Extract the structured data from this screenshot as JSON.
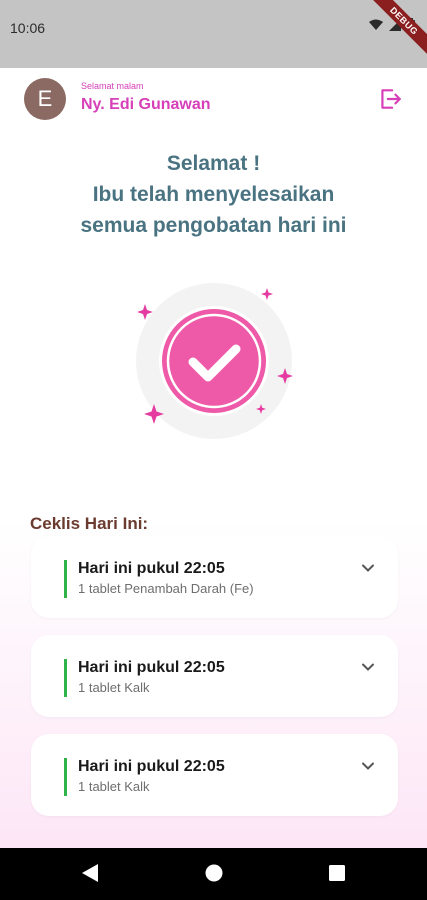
{
  "status_bar": {
    "time": "10:06",
    "debug_label": "DEBUG"
  },
  "header": {
    "avatar_initial": "E",
    "greeting": "Selamat malam",
    "user_name": "Ny. Edi Gunawan"
  },
  "congrats": {
    "line1": "Selamat !",
    "line2": "Ibu telah menyelesaikan",
    "line3": "semua pengobatan hari ini"
  },
  "checklist": {
    "title": "Ceklis Hari Ini:",
    "items": [
      {
        "time": "Hari ini pukul 22:05",
        "dose": "1 tablet Penambah Darah (Fe)"
      },
      {
        "time": "Hari ini pukul 22:05",
        "dose": "1 tablet Kalk"
      },
      {
        "time": "Hari ini pukul 22:05",
        "dose": "1 tablet Kalk"
      }
    ]
  },
  "colors": {
    "accent": "#d63fb8",
    "heading": "#4a7382",
    "done_marker": "#2fb34a",
    "check_circle": "#ee5aa8"
  },
  "icons": [
    "logout-icon",
    "check-icon",
    "sparkle-icon",
    "chevron-down-icon",
    "back-icon",
    "home-icon",
    "recents-icon",
    "wifi-icon",
    "signal-icon",
    "battery-icon"
  ]
}
